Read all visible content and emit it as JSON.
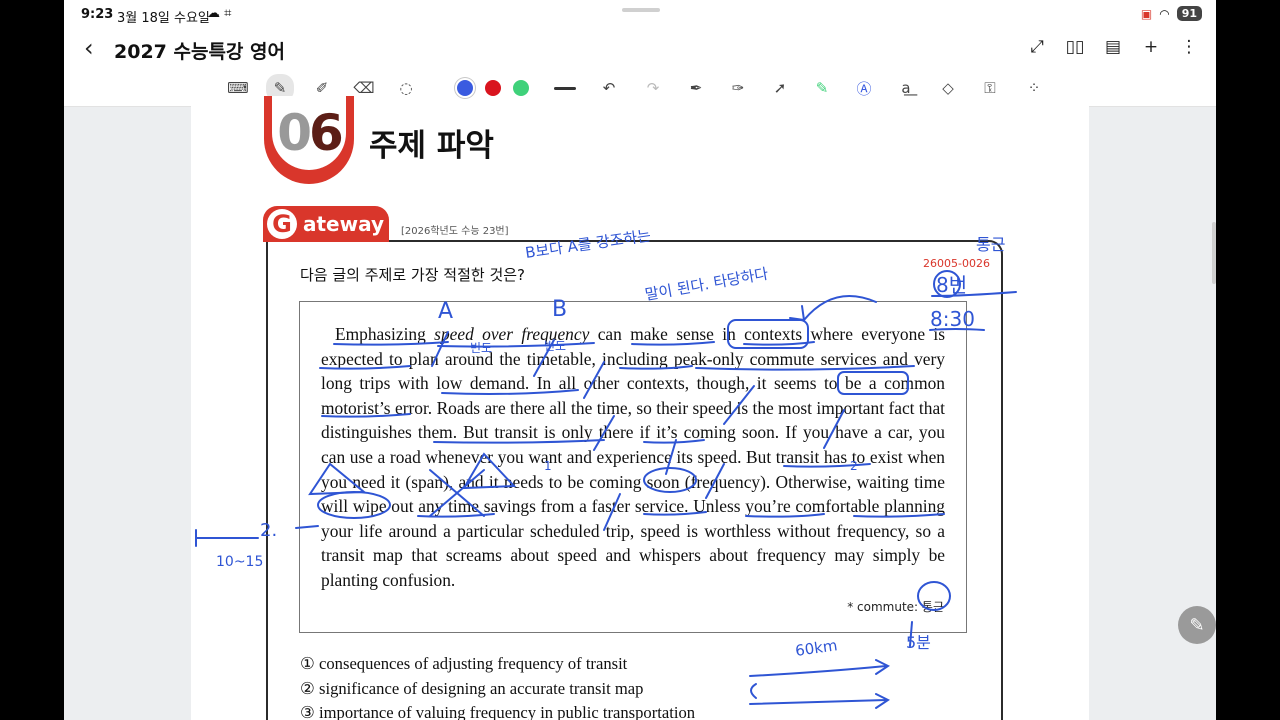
{
  "status": {
    "time": "9:23",
    "date": "3월 18일 수요일",
    "battery": "91"
  },
  "header": {
    "title": "2027 수능특강 영어"
  },
  "toolbar": {
    "pen_colors": [
      "#3a5be0",
      "#d9141e",
      "#3fd17a"
    ]
  },
  "page": {
    "section_number_prefix": "0",
    "section_number_suffix": "6",
    "section_title": "주제 파악",
    "gateway_letter": "G",
    "gateway_word": "ateway",
    "source": "[2026학년도 수능 23번]",
    "question_code": "26005-0026",
    "question": "다음 글의 주제로 가장 적절한 것은?",
    "passage": {
      "p1": "Emphasizing ",
      "p1_italic": "speed over frequency",
      "p2": " can make sense in contexts where everyone is expected to plan around the timetable, including peak-only commute services and very long trips with low demand. In all other contexts, though, it seems to be a common motorist’s error. Roads are there all the time, so their speed is the most important fact that distinguishes them. But transit is only there if it’s coming soon. If you have a car, you can use a road whenever you want and experience its speed. But transit has to exist when you need it (span), and it needs to be coming soon (frequency). Otherwise, waiting time will wipe out any time savings from a faster service. Unless you’re comfortable planning your life around a particular scheduled trip, speed is worthless without frequency, so a transit map that screams about speed and whispers about frequency may simply be planting confusion."
    },
    "footnote": "* commute: 통근",
    "choices": [
      "① consequences of adjusting frequency of transit",
      "② significance of designing an accurate transit map",
      "③ importance of valuing frequency in public transportation"
    ]
  },
  "ink_notes": {
    "a": "A",
    "b": "B",
    "top1": "B보다 A를 강조하는",
    "top2": "말이 된다. 타당하다",
    "corner1": "통근",
    "corner2": "8번",
    "corner3": "8:30",
    "left1": "2.",
    "left2": "10~15",
    "m1": "빈도",
    "m2": "빈도",
    "m3": "1",
    "m4": "2",
    "bottom1": "60km",
    "bottom2": "5분"
  }
}
